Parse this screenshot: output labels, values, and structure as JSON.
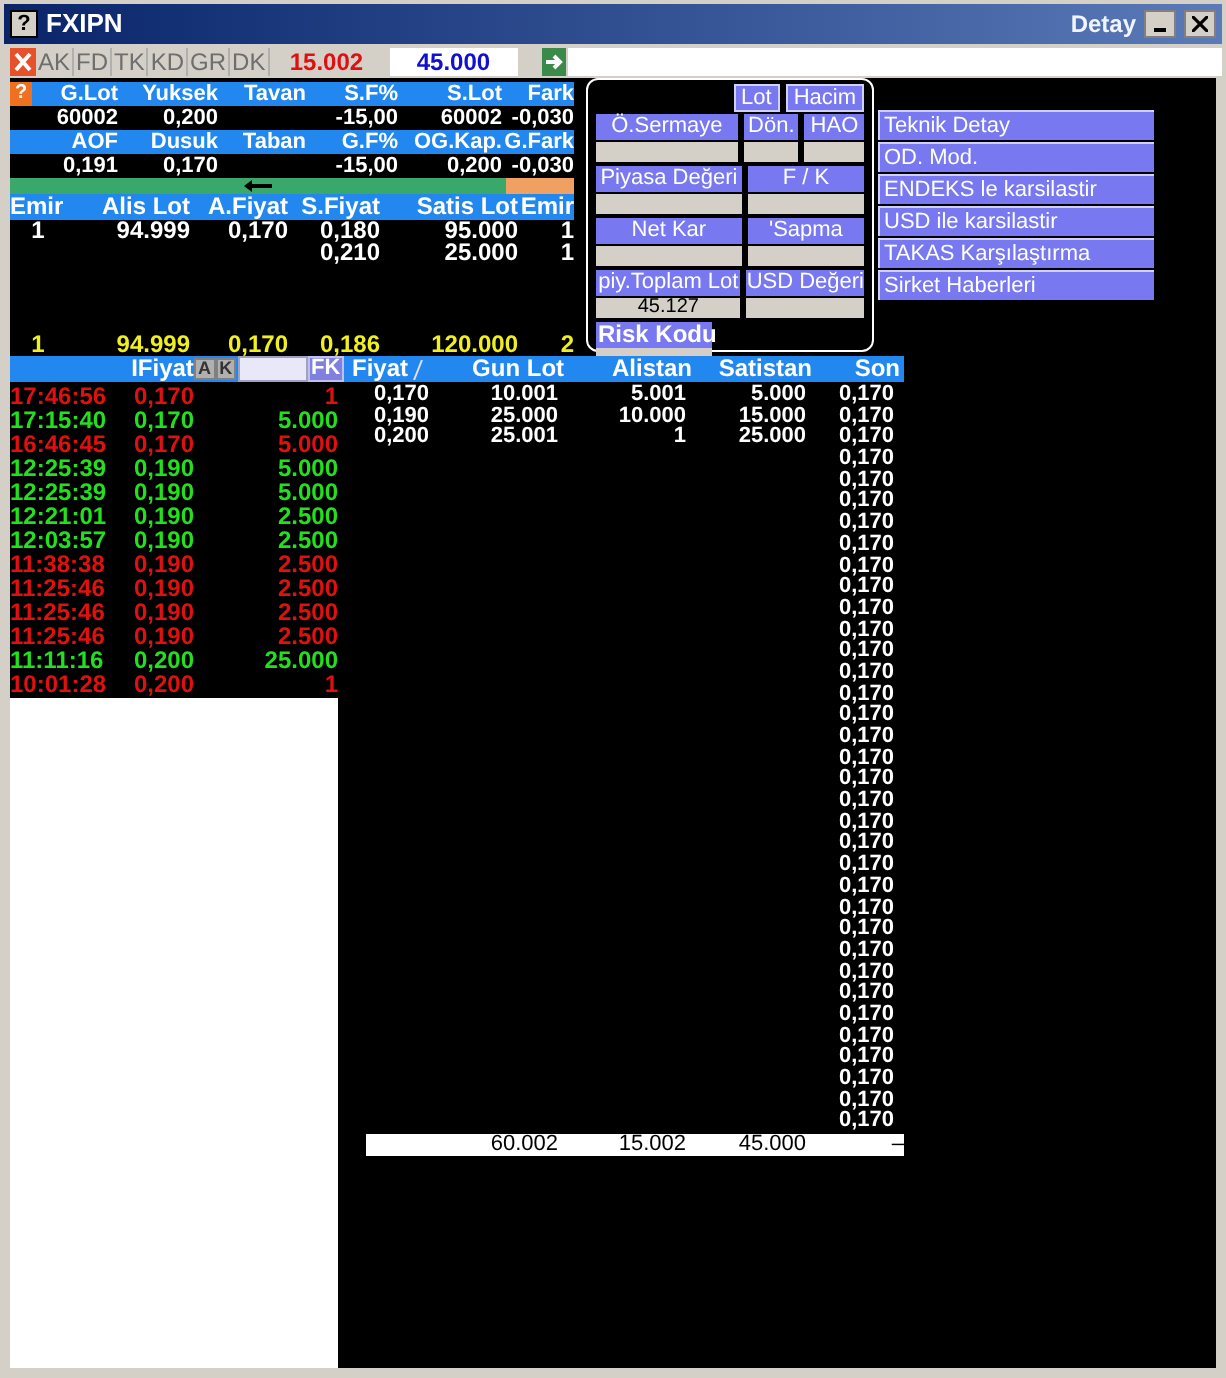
{
  "window": {
    "help_glyph": "?",
    "title": "FXIPN",
    "faded_title": "Detay"
  },
  "toolbar": {
    "tabs": [
      {
        "label": "AK",
        "disabled": true
      },
      {
        "label": "FD",
        "disabled": true
      },
      {
        "label": "TK",
        "disabled": true
      },
      {
        "label": "KD",
        "disabled": true
      },
      {
        "label": "GR",
        "disabled": true
      },
      {
        "label": "DK",
        "disabled": true
      }
    ],
    "sell_value": "15.002",
    "buy_value": "45.000"
  },
  "summary": {
    "help_glyph": "?",
    "block_1": [
      {
        "header": "G.Lot",
        "value": "60002"
      },
      {
        "header": "Yuksek",
        "value": "0,200"
      },
      {
        "header": "Tavan"
      },
      {
        "header": "S.F%",
        "value": "-15,00"
      },
      {
        "header": "S.Lot",
        "value": "60002"
      },
      {
        "header": "Fark",
        "value": "-0,030"
      }
    ],
    "block_2": [
      {
        "header": "AOF",
        "value": "0,191"
      },
      {
        "header": "Dusuk",
        "value": "0,170"
      },
      {
        "header": "Taban"
      },
      {
        "header": "G.F%",
        "value": "-15,00"
      },
      {
        "header": "OG.Kap.",
        "value": "0,200"
      },
      {
        "header": "G.Fark",
        "value": "-0,030"
      }
    ]
  },
  "depth": {
    "columns": [
      "Emir",
      "Alis Lot",
      "A.Fiyat",
      "S.Fiyat",
      "Satis Lot",
      "Emir"
    ],
    "rows": [
      [
        "1",
        "94.999",
        "0,170",
        "0,180",
        "95.000",
        "1"
      ],
      [
        null,
        null,
        null,
        "0,210",
        "25.000",
        "1"
      ]
    ],
    "totals": [
      "1",
      "94.999",
      "0,170",
      "0,186",
      "120.000",
      "2"
    ]
  },
  "trades_header": {
    "label": "IFiyat",
    "buttons": [
      "A",
      "K"
    ],
    "fk": "FK"
  },
  "trades": [
    {
      "time": "17:46:56",
      "price": "0,170",
      "lot": "1",
      "color": "#e01010"
    },
    {
      "time": "17:15:40",
      "price": "0,170",
      "lot": "5.000",
      "color": "#22e01e"
    },
    {
      "time": "16:46:45",
      "price": "0,170",
      "lot": "5.000",
      "color": "#e01010"
    },
    {
      "time": "12:25:39",
      "price": "0,190",
      "lot": "5.000",
      "color": "#22e01e"
    },
    {
      "time": "12:25:39",
      "price": "0,190",
      "lot": "5.000",
      "color": "#22e01e"
    },
    {
      "time": "12:21:01",
      "price": "0,190",
      "lot": "2.500",
      "color": "#22e01e"
    },
    {
      "time": "12:03:57",
      "price": "0,190",
      "lot": "2.500",
      "color": "#22e01e"
    },
    {
      "time": "11:38:38",
      "price": "0,190",
      "lot": "2.500",
      "color": "#e01010"
    },
    {
      "time": "11:25:46",
      "price": "0,190",
      "lot": "2.500",
      "color": "#e01010"
    },
    {
      "time": "11:25:46",
      "price": "0,190",
      "lot": "2.500",
      "color": "#e01010"
    },
    {
      "time": "11:25:46",
      "price": "0,190",
      "lot": "2.500",
      "color": "#e01010"
    },
    {
      "time": "11:11:16",
      "price": "0,200",
      "lot": "25.000",
      "color": "#22e01e"
    },
    {
      "time": "10:01:28",
      "price": "0,200",
      "lot": "1",
      "color": "#e01010"
    }
  ],
  "volume": {
    "columns": [
      "Fiyat",
      "Gun Lot",
      "Alistan",
      "Satistan",
      "Son"
    ],
    "rows": [
      [
        "0,170",
        "10.001",
        "5.001",
        "5.000",
        "0,170"
      ],
      [
        "0,190",
        "25.000",
        "10.000",
        "15.000",
        "0,170"
      ],
      [
        "0,200",
        "25.001",
        "1",
        "25.000",
        "0,170"
      ],
      [
        "",
        "",
        "",
        "",
        "0,170"
      ],
      [
        "",
        "",
        "",
        "",
        "0,170"
      ],
      [
        "",
        "",
        "",
        "",
        "0,170"
      ],
      [
        "",
        "",
        "",
        "",
        "0,170"
      ],
      [
        "",
        "",
        "",
        "",
        "0,170"
      ],
      [
        "",
        "",
        "",
        "",
        "0,170"
      ],
      [
        "",
        "",
        "",
        "",
        "0,170"
      ],
      [
        "",
        "",
        "",
        "",
        "0,170"
      ],
      [
        "",
        "",
        "",
        "",
        "0,170"
      ],
      [
        "",
        "",
        "",
        "",
        "0,170"
      ],
      [
        "",
        "",
        "",
        "",
        "0,170"
      ],
      [
        "",
        "",
        "",
        "",
        "0,170"
      ],
      [
        "",
        "",
        "",
        "",
        "0,170"
      ],
      [
        "",
        "",
        "",
        "",
        "0,170"
      ],
      [
        "",
        "",
        "",
        "",
        "0,170"
      ],
      [
        "",
        "",
        "",
        "",
        "0,170"
      ],
      [
        "",
        "",
        "",
        "",
        "0,170"
      ],
      [
        "",
        "",
        "",
        "",
        "0,170"
      ],
      [
        "",
        "",
        "",
        "",
        "0,170"
      ],
      [
        "",
        "",
        "",
        "",
        "0,170"
      ],
      [
        "",
        "",
        "",
        "",
        "0,170"
      ],
      [
        "",
        "",
        "",
        "",
        "0,170"
      ],
      [
        "",
        "",
        "",
        "",
        "0,170"
      ],
      [
        "",
        "",
        "",
        "",
        "0,170"
      ],
      [
        "",
        "",
        "",
        "",
        "0,170"
      ],
      [
        "",
        "",
        "",
        "",
        "0,170"
      ],
      [
        "",
        "",
        "",
        "",
        "0,170"
      ],
      [
        "",
        "",
        "",
        "",
        "0,170"
      ],
      [
        "",
        "",
        "",
        "",
        "0,170"
      ],
      [
        "",
        "",
        "",
        "",
        "0,170"
      ],
      [
        "",
        "",
        "",
        "",
        "0,170"
      ],
      [
        "",
        "",
        "",
        "",
        "0,170"
      ]
    ],
    "footer": [
      "60.002",
      "15.002",
      "45.000",
      "–"
    ]
  },
  "popup": {
    "buttons": [
      "Lot",
      "Hacim"
    ],
    "fields": [
      {
        "label": "Ö.Sermaye"
      },
      {
        "label": "Dön."
      },
      {
        "label": "HAO"
      },
      {
        "label": "Piyasa Değeri"
      },
      {
        "label": "F / K"
      },
      {
        "label": "Net Kar"
      },
      {
        "label": "'Sapma"
      },
      {
        "label": "piy.Toplam Lot",
        "value": "45.127"
      },
      {
        "label": "USD Değeri"
      }
    ],
    "risk_label": "Risk Kodu"
  },
  "menu": [
    "Teknik Detay",
    "OD. Mod.",
    "ENDEKS le karsilastir",
    "USD ile karsilastir",
    "TAKAS Karşılaştırma",
    "Sirket Haberleri"
  ]
}
